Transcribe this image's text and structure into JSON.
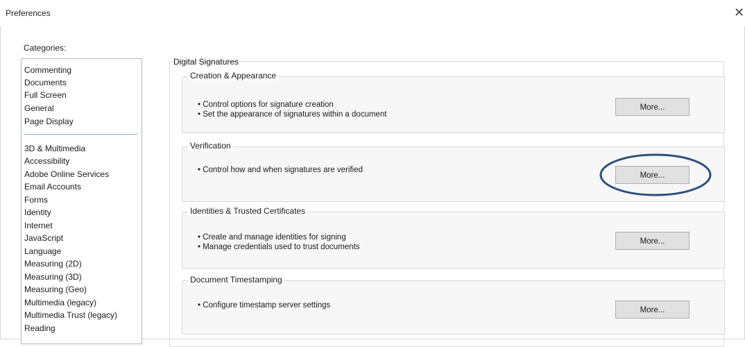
{
  "window": {
    "title": "Preferences",
    "close_glyph": "✕"
  },
  "categories": {
    "label": "Categories:",
    "group1": [
      "Commenting",
      "Documents",
      "Full Screen",
      "General",
      "Page Display"
    ],
    "group2": [
      "3D & Multimedia",
      "Accessibility",
      "Adobe Online Services",
      "Email Accounts",
      "Forms",
      "Identity",
      "Internet",
      "JavaScript",
      "Language",
      "Measuring (2D)",
      "Measuring (3D)",
      "Measuring (Geo)",
      "Multimedia (legacy)",
      "Multimedia Trust (legacy)",
      "Reading"
    ]
  },
  "main": {
    "section_title": "Digital Signatures",
    "groups": [
      {
        "title": "Creation & Appearance",
        "bullets": [
          "• Control options for signature creation",
          "• Set the appearance of signatures within a document"
        ],
        "button": "More..."
      },
      {
        "title": "Verification",
        "bullets": [
          "• Control how and when signatures are verified"
        ],
        "button": "More..."
      },
      {
        "title": "Identities & Trusted Certificates",
        "bullets": [
          "• Create and manage identities for signing",
          "• Manage credentials used to trust documents"
        ],
        "button": "More..."
      },
      {
        "title": "Document Timestamping",
        "bullets": [
          "• Configure timestamp server settings"
        ],
        "button": "More..."
      }
    ]
  },
  "annotation": {
    "highlight_color": "#2d4f7c"
  }
}
